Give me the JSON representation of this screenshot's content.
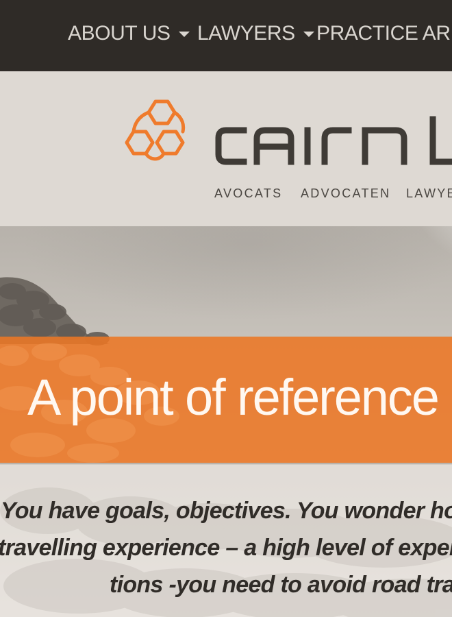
{
  "nav": {
    "items": [
      {
        "label": "ABOUT US"
      },
      {
        "label": "LAWYERS"
      },
      {
        "label": "PRACTICE AREA"
      }
    ]
  },
  "brand": {
    "name": "CAIRN L",
    "tags": [
      "AVOCATS",
      "ADVOCATEN",
      "LAWYE"
    ],
    "logo_color": "#ef7b2c",
    "text_color": "#3f3b36"
  },
  "hero": {
    "title": "A point of reference c",
    "intro": [
      "You have goals, objectives. You wonder how",
      "travelling experience – a high level of experti",
      "tions -you need to avoid road trap"
    ],
    "banner_color": "#ec7624"
  }
}
